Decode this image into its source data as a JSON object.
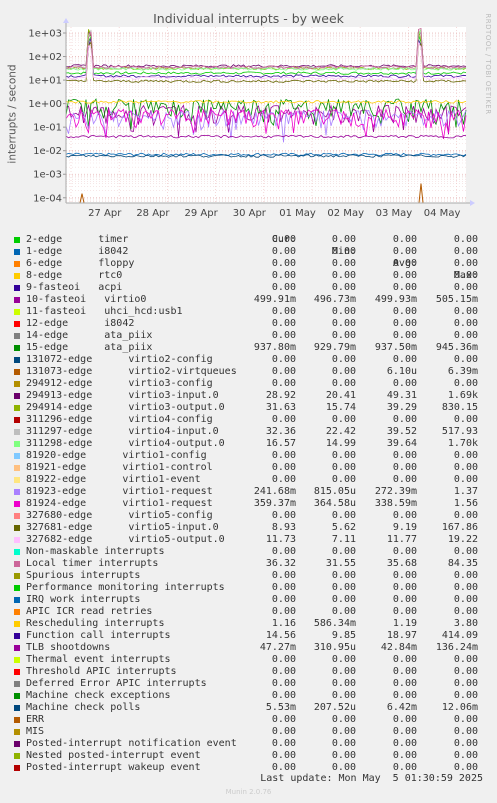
{
  "title": "Individual interrupts - by week",
  "ylabel": "interrupts / second",
  "side_label": "RRDTOOL / TOBI OETIKER",
  "header": {
    "cur": "Cur:",
    "min": "Min:",
    "avg": "Avg:",
    "max": "Max:"
  },
  "chart_data": {
    "type": "line",
    "title": "Individual interrupts - by week",
    "ylabel": "interrupts / second",
    "yscale": "log",
    "ylim": [
      6e-05,
      1800
    ],
    "yticks": [
      "1e+03",
      "1e+02",
      "1e+01",
      "1e+00",
      "1e-01",
      "1e-02",
      "1e-03",
      "1e-04"
    ],
    "xticks": [
      "27 Apr",
      "28 Apr",
      "29 Apr",
      "30 Apr",
      "01 May",
      "02 May",
      "03 May",
      "04 May"
    ],
    "grid": true,
    "series": [
      {
        "name": "2-edge      timer",
        "color": "#00cc00",
        "cur": "0.00",
        "min": "0.00",
        "avg": "0.00",
        "max": "0.00"
      },
      {
        "name": "1-edge      i8042",
        "color": "#0066b3",
        "cur": "0.00",
        "min": "0.00",
        "avg": "0.00",
        "max": "0.00"
      },
      {
        "name": "6-edge      floppy",
        "color": "#ff8000",
        "cur": "0.00",
        "min": "0.00",
        "avg": "0.00",
        "max": "0.00"
      },
      {
        "name": "8-edge      rtc0",
        "color": "#ffcc00",
        "cur": "0.00",
        "min": "0.00",
        "avg": "0.00",
        "max": "0.00"
      },
      {
        "name": "9-fasteoi   acpi",
        "color": "#330099",
        "cur": "0.00",
        "min": "0.00",
        "avg": "0.00",
        "max": "0.00"
      },
      {
        "name": "10-fasteoi   virtio0",
        "color": "#990099",
        "cur": "499.91m",
        "min": "496.73m",
        "avg": "499.93m",
        "max": "505.15m"
      },
      {
        "name": "11-fasteoi   uhci_hcd:usb1",
        "color": "#ccff00",
        "cur": "0.00",
        "min": "0.00",
        "avg": "0.00",
        "max": "0.00"
      },
      {
        "name": "12-edge      i8042",
        "color": "#ff0000",
        "cur": "0.00",
        "min": "0.00",
        "avg": "0.00",
        "max": "0.00"
      },
      {
        "name": "14-edge      ata_piix",
        "color": "#808080",
        "cur": "0.00",
        "min": "0.00",
        "avg": "0.00",
        "max": "0.00"
      },
      {
        "name": "15-edge      ata_piix",
        "color": "#008f00",
        "cur": "937.80m",
        "min": "929.79m",
        "avg": "937.50m",
        "max": "945.36m"
      },
      {
        "name": "131072-edge      virtio2-config",
        "color": "#00487d",
        "cur": "0.00",
        "min": "0.00",
        "avg": "0.00",
        "max": "0.00"
      },
      {
        "name": "131073-edge      virtio2-virtqueues",
        "color": "#b35a00",
        "cur": "0.00",
        "min": "0.00",
        "avg": "6.10u",
        "max": "6.39m"
      },
      {
        "name": "294912-edge      virtio3-config",
        "color": "#b38f00",
        "cur": "0.00",
        "min": "0.00",
        "avg": "0.00",
        "max": "0.00"
      },
      {
        "name": "294913-edge      virtio3-input.0",
        "color": "#6b006b",
        "cur": "28.92",
        "min": "20.41",
        "avg": "49.31",
        "max": "1.69k"
      },
      {
        "name": "294914-edge      virtio3-output.0",
        "color": "#8fb300",
        "cur": "31.63",
        "min": "15.74",
        "avg": "39.29",
        "max": "830.15"
      },
      {
        "name": "311296-edge      virtio4-config",
        "color": "#b30000",
        "cur": "0.00",
        "min": "0.00",
        "avg": "0.00",
        "max": "0.00"
      },
      {
        "name": "311297-edge      virtio4-input.0",
        "color": "#bebebe",
        "cur": "32.36",
        "min": "22.42",
        "avg": "39.52",
        "max": "517.93"
      },
      {
        "name": "311298-edge      virtio4-output.0",
        "color": "#80ff80",
        "cur": "16.57",
        "min": "14.99",
        "avg": "39.64",
        "max": "1.70k"
      },
      {
        "name": "81920-edge      virtio1-config",
        "color": "#80c9ff",
        "cur": "0.00",
        "min": "0.00",
        "avg": "0.00",
        "max": "0.00"
      },
      {
        "name": "81921-edge      virtio1-control",
        "color": "#ffc080",
        "cur": "0.00",
        "min": "0.00",
        "avg": "0.00",
        "max": "0.00"
      },
      {
        "name": "81922-edge      virtio1-event",
        "color": "#ffe680",
        "cur": "0.00",
        "min": "0.00",
        "avg": "0.00",
        "max": "0.00"
      },
      {
        "name": "81923-edge      virtio1-request",
        "color": "#aa80ff",
        "cur": "241.68m",
        "min": "815.05u",
        "avg": "272.39m",
        "max": "1.37"
      },
      {
        "name": "81924-edge      virtio1-request",
        "color": "#ee00cc",
        "cur": "359.37m",
        "min": "364.58u",
        "avg": "338.59m",
        "max": "1.56"
      },
      {
        "name": "327680-edge      virtio5-config",
        "color": "#ff8080",
        "cur": "0.00",
        "min": "0.00",
        "avg": "0.00",
        "max": "0.00"
      },
      {
        "name": "327681-edge      virtio5-input.0",
        "color": "#666600",
        "cur": "8.93",
        "min": "5.62",
        "avg": "9.19",
        "max": "167.86"
      },
      {
        "name": "327682-edge      virtio5-output.0",
        "color": "#ffbfff",
        "cur": "11.73",
        "min": "7.11",
        "avg": "11.77",
        "max": "19.22"
      },
      {
        "name": "Non-maskable interrupts",
        "color": "#00ffcc",
        "cur": "0.00",
        "min": "0.00",
        "avg": "0.00",
        "max": "0.00"
      },
      {
        "name": "Local timer interrupts",
        "color": "#cc6699",
        "cur": "36.32",
        "min": "31.55",
        "avg": "35.68",
        "max": "84.35"
      },
      {
        "name": "Spurious interrupts",
        "color": "#999900",
        "cur": "0.00",
        "min": "0.00",
        "avg": "0.00",
        "max": "0.00"
      },
      {
        "name": "Performance monitoring interrupts",
        "color": "#00cc00",
        "cur": "0.00",
        "min": "0.00",
        "avg": "0.00",
        "max": "0.00"
      },
      {
        "name": "IRQ work interrupts",
        "color": "#0066b3",
        "cur": "0.00",
        "min": "0.00",
        "avg": "0.00",
        "max": "0.00"
      },
      {
        "name": "APIC ICR read retries",
        "color": "#ff8000",
        "cur": "0.00",
        "min": "0.00",
        "avg": "0.00",
        "max": "0.00"
      },
      {
        "name": "Rescheduling interrupts",
        "color": "#ffcc00",
        "cur": "1.16",
        "min": "586.34m",
        "avg": "1.19",
        "max": "3.80"
      },
      {
        "name": "Function call interrupts",
        "color": "#330099",
        "cur": "14.56",
        "min": "9.85",
        "avg": "18.97",
        "max": "414.09"
      },
      {
        "name": "TLB shootdowns",
        "color": "#990099",
        "cur": "47.27m",
        "min": "310.95u",
        "avg": "42.84m",
        "max": "136.24m"
      },
      {
        "name": "Thermal event interrupts",
        "color": "#ccff00",
        "cur": "0.00",
        "min": "0.00",
        "avg": "0.00",
        "max": "0.00"
      },
      {
        "name": "Threshold APIC interrupts",
        "color": "#ff0000",
        "cur": "0.00",
        "min": "0.00",
        "avg": "0.00",
        "max": "0.00"
      },
      {
        "name": "Deferred Error APIC interrupts",
        "color": "#808080",
        "cur": "0.00",
        "min": "0.00",
        "avg": "0.00",
        "max": "0.00"
      },
      {
        "name": "Machine check exceptions",
        "color": "#008f00",
        "cur": "0.00",
        "min": "0.00",
        "avg": "0.00",
        "max": "0.00"
      },
      {
        "name": "Machine check polls",
        "color": "#00487d",
        "cur": "5.53m",
        "min": "207.52u",
        "avg": "6.42m",
        "max": "12.06m"
      },
      {
        "name": "ERR",
        "color": "#b35a00",
        "cur": "0.00",
        "min": "0.00",
        "avg": "0.00",
        "max": "0.00"
      },
      {
        "name": "MIS",
        "color": "#b38f00",
        "cur": "0.00",
        "min": "0.00",
        "avg": "0.00",
        "max": "0.00"
      },
      {
        "name": "Posted-interrupt notification event",
        "color": "#6b006b",
        "cur": "0.00",
        "min": "0.00",
        "avg": "0.00",
        "max": "0.00"
      },
      {
        "name": "Nested posted-interrupt event",
        "color": "#8fb300",
        "cur": "0.00",
        "min": "0.00",
        "avg": "0.00",
        "max": "0.00"
      },
      {
        "name": "Posted-interrupt wakeup event",
        "color": "#b30000",
        "cur": "0.00",
        "min": "0.00",
        "avg": "0.00",
        "max": "0.00"
      }
    ],
    "plot_levels": [
      {
        "color": "#00cc00",
        "value": 20
      },
      {
        "color": "#0066b3",
        "value": 0.007
      },
      {
        "color": "#330099",
        "value": 15
      },
      {
        "color": "#990099",
        "value": 0.5
      },
      {
        "color": "#008f00",
        "value": 0.94
      },
      {
        "color": "#6b006b",
        "value": 40
      },
      {
        "color": "#8fb300",
        "value": 32
      },
      {
        "color": "#bebebe",
        "value": 33
      },
      {
        "color": "#80ff80",
        "value": 30
      },
      {
        "color": "#aa80ff",
        "value": 0.3
      },
      {
        "color": "#ee00cc",
        "value": 0.34
      },
      {
        "color": "#666600",
        "value": 9
      },
      {
        "color": "#ffbfff",
        "value": 12
      },
      {
        "color": "#cc6699",
        "value": 36
      },
      {
        "color": "#ffcc00",
        "value": 1.2
      },
      {
        "color": "#990099",
        "value": 0.04
      },
      {
        "color": "#00487d",
        "value": 0.006
      }
    ]
  },
  "last_update": "Last update: Mon May  5 01:30:59 2025",
  "footer": "Munin 2.0.76"
}
